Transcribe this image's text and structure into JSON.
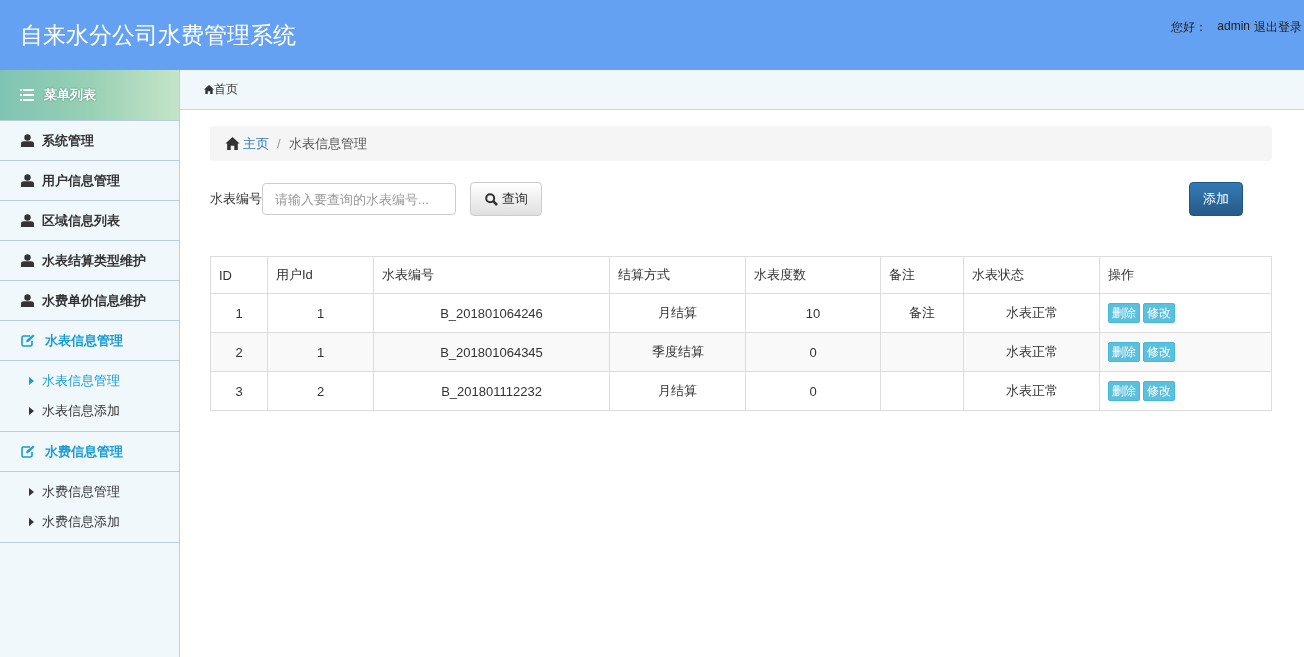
{
  "header": {
    "title": "自来水分公司水费管理系统",
    "greeting": "您好：",
    "user": "admin",
    "logout": "退出登录"
  },
  "sidebar": {
    "title": "菜单列表",
    "items": [
      {
        "kind": "link",
        "label": "系统管理"
      },
      {
        "kind": "link",
        "label": "用户信息管理"
      },
      {
        "kind": "link",
        "label": "区域信息列表"
      },
      {
        "kind": "link",
        "label": "水表结算类型维护"
      },
      {
        "kind": "link",
        "label": "水费单价信息维护"
      },
      {
        "kind": "group",
        "label": "水表信息管理",
        "children": [
          {
            "label": "水表信息管理",
            "selected": true
          },
          {
            "label": "水表信息添加",
            "selected": false
          }
        ]
      },
      {
        "kind": "group",
        "label": "水费信息管理",
        "children": [
          {
            "label": "水费信息管理",
            "selected": false
          },
          {
            "label": "水费信息添加",
            "selected": false
          }
        ]
      }
    ]
  },
  "topbar": {
    "home": "首页"
  },
  "breadcrumb_separator": "/",
  "breadcrumb": [
    {
      "label": "主页",
      "selected": false
    },
    {
      "label": "水表信息管理",
      "selected": true
    }
  ],
  "search": {
    "label": "水表编号",
    "placeholder": "请输入要查询的水表编号...",
    "button": "查询"
  },
  "add_button": "添加",
  "table": {
    "columns": [
      "ID",
      "用户Id",
      "水表编号",
      "结算方式",
      "水表度数",
      "备注",
      "水表状态",
      "操作"
    ],
    "rows": [
      {
        "cells": [
          "1",
          "1",
          "B_201801064246",
          "月结算",
          "10",
          "备注",
          "水表正常"
        ],
        "actions": [
          "删除",
          "修改"
        ]
      },
      {
        "cells": [
          "2",
          "1",
          "B_201801064345",
          "季度结算",
          "0",
          "",
          "水表正常"
        ],
        "actions": [
          "删除",
          "修改"
        ]
      },
      {
        "cells": [
          "3",
          "2",
          "B_201801112232",
          "月结算",
          "0",
          "",
          "水表正常"
        ],
        "actions": [
          "删除",
          "修改"
        ]
      }
    ]
  }
}
